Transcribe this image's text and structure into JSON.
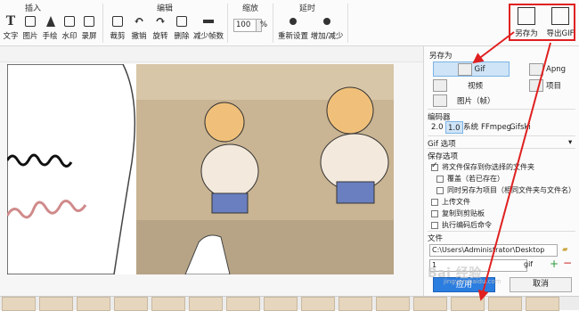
{
  "ribbon": {
    "groups": [
      {
        "title": "插入",
        "buttons": [
          "文字",
          "图片",
          "手绘",
          "水印",
          "录屏"
        ]
      },
      {
        "title": "编辑",
        "buttons": [
          "裁剪",
          "撤销",
          "旋转",
          "删除",
          "减少帧数"
        ]
      },
      {
        "title": "缩放",
        "zoom_value": "100",
        "zoom_unit": "%"
      },
      {
        "title": "延时",
        "buttons": [
          "重新设置",
          "增加/减少"
        ]
      }
    ],
    "save_as": "另存为",
    "export_gif": "导出GIF"
  },
  "panel": {
    "section_title": "另存为",
    "formats": [
      {
        "label": "Gif"
      },
      {
        "label": "Apng"
      },
      {
        "label": "视频"
      },
      {
        "label": "项目"
      },
      {
        "label": "图片（帧）"
      }
    ],
    "encoder_title": "编码器",
    "encoders": [
      "2.0",
      "1.0",
      "系统",
      "FFmpeg",
      "Gifski"
    ],
    "gif_options": "Gif 选项",
    "save_options": "保存选项",
    "checkboxes": [
      {
        "label": "将文件保存到你选择的文件夹",
        "checked": true
      },
      {
        "label": "覆盖（若已存在）",
        "checked": false
      },
      {
        "label": "同时另存为项目（相同文件夹与文件名）",
        "checked": false
      },
      {
        "label": "上传文件",
        "checked": false
      },
      {
        "label": "复制到剪贴板",
        "checked": false
      },
      {
        "label": "执行编码后命令",
        "checked": false
      }
    ],
    "file_title": "文件",
    "path": "C:\\Users\\Administrator\\Desktop",
    "file_name": "1",
    "extension": "gif",
    "apply": "应用",
    "cancel": "取消"
  },
  "watermark": {
    "main": "Bai 经验",
    "sub": "jingyan.baidu.com"
  },
  "colors": {
    "accent": "#2b7de0",
    "selection": "#cfe4f7",
    "annotation": "#e02020"
  }
}
